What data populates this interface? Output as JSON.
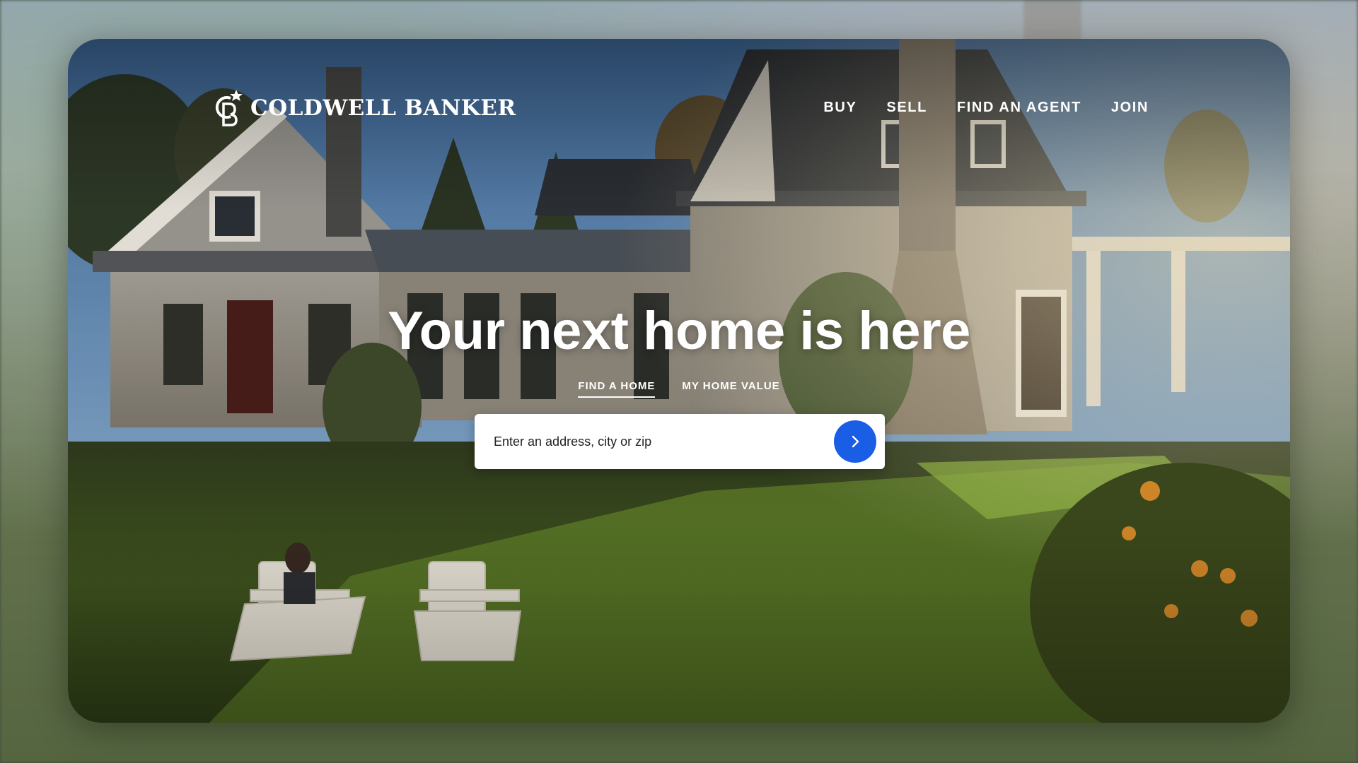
{
  "brand": {
    "name": "COLDWELL BANKER",
    "accent": "#1a5ee6"
  },
  "nav": {
    "items": [
      {
        "label": "BUY"
      },
      {
        "label": "SELL"
      },
      {
        "label": "FIND AN AGENT"
      },
      {
        "label": "JOIN"
      }
    ]
  },
  "hero": {
    "title": "Your next home is here",
    "tabs": [
      {
        "label": "FIND A HOME",
        "active": true
      },
      {
        "label": "MY HOME VALUE",
        "active": false
      }
    ],
    "search": {
      "placeholder": "Enter an address, city or zip",
      "button_icon": "chevron-right-icon"
    }
  }
}
